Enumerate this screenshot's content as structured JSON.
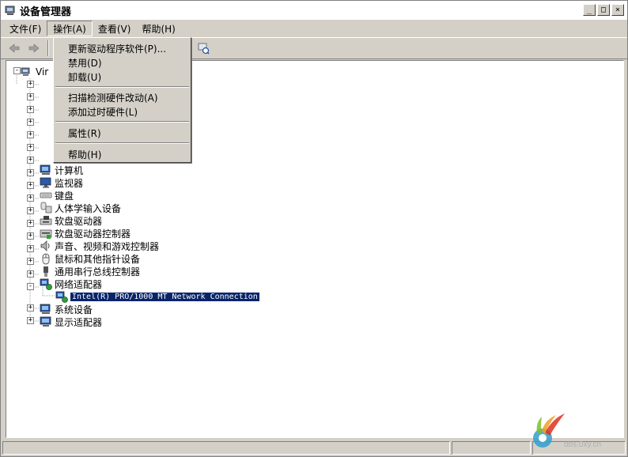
{
  "window": {
    "title": "设备管理器"
  },
  "window_controls": {
    "minimize": "_",
    "maximize": "□",
    "close": "×"
  },
  "menubar": [
    {
      "label": "文件(F)"
    },
    {
      "label": "操作(A)"
    },
    {
      "label": "查看(V)"
    },
    {
      "label": "帮助(H)"
    }
  ],
  "action_menu": {
    "items": [
      {
        "label": "更新驱动程序软件(P)..."
      },
      {
        "label": "禁用(D)"
      },
      {
        "label": "卸载(U)"
      },
      {
        "label": "扫描检测硬件改动(A)"
      },
      {
        "label": "添加过时硬件(L)"
      },
      {
        "label": "属性(R)"
      },
      {
        "label": "帮助(H)"
      }
    ]
  },
  "tree": {
    "root": "Vir",
    "items": [
      {
        "label": "计算机"
      },
      {
        "label": "监视器"
      },
      {
        "label": "键盘"
      },
      {
        "label": "人体学输入设备"
      },
      {
        "label": "软盘驱动器"
      },
      {
        "label": "软盘驱动器控制器"
      },
      {
        "label": "声音、视频和游戏控制器"
      },
      {
        "label": "鼠标和其他指针设备"
      },
      {
        "label": "通用串行总线控制器"
      },
      {
        "label": "网络适配器"
      },
      {
        "label": "Intel(R) PRO/1000 MT Network Connection"
      },
      {
        "label": "系统设备"
      },
      {
        "label": "显示适配器"
      }
    ]
  },
  "watermark": {
    "text": "bbs.0xy.cn"
  },
  "colors": {
    "selection": "#0a246a",
    "window_bg": "#d4d0c8"
  }
}
